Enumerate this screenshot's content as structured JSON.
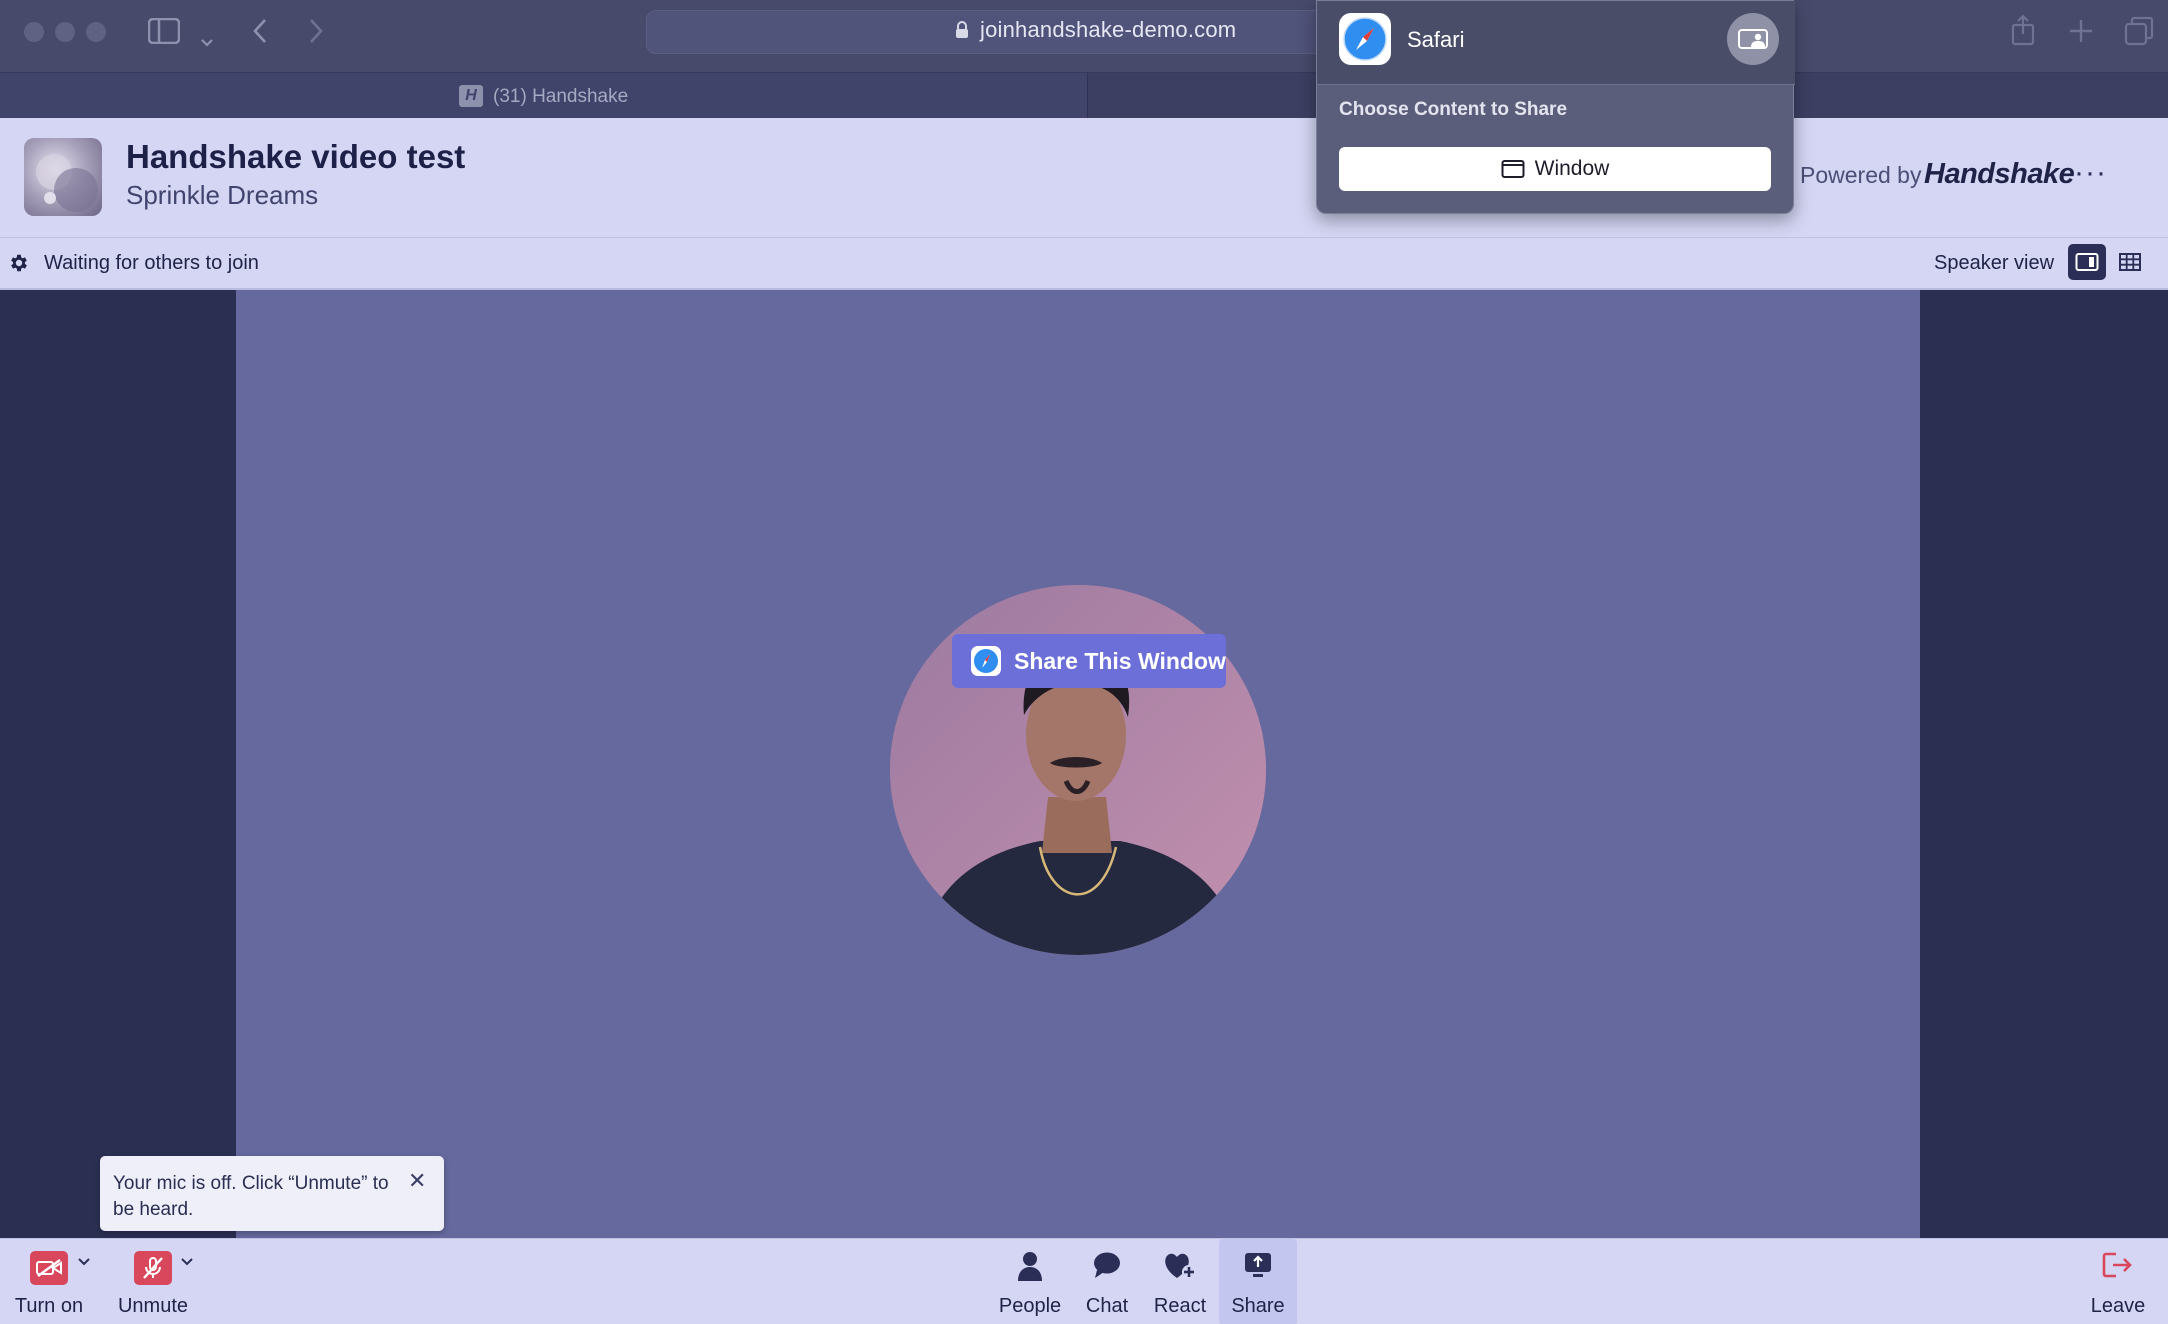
{
  "browser": {
    "url": "joinhandshake-demo.com",
    "tab_title": "(31) Handshake",
    "tab_favicon_letter": "H"
  },
  "header": {
    "title": "Handshake video test",
    "subtitle": "Sprinkle Dreams",
    "powered_by": "Powered by",
    "brand": "Handshake",
    "more": "···"
  },
  "status_bar": {
    "status": "Waiting for others to join",
    "view_label": "Speaker view"
  },
  "stage": {
    "share_window_label": "Share This Window"
  },
  "toast": {
    "message": "Your mic is off. Click “Unmute” to be heard.",
    "close": "✕"
  },
  "toolbar": {
    "camera_label": "Turn on",
    "mic_label": "Unmute",
    "people_label": "People",
    "chat_label": "Chat",
    "react_label": "React",
    "share_label": "Share",
    "leave_label": "Leave"
  },
  "share_popover": {
    "app_name": "Safari",
    "heading": "Choose Content to Share",
    "window_label": "Window"
  },
  "colors": {
    "accent": "#6c6fd8",
    "danger": "#d9475c",
    "navy": "#2b2f57",
    "tile": "#65699e"
  }
}
